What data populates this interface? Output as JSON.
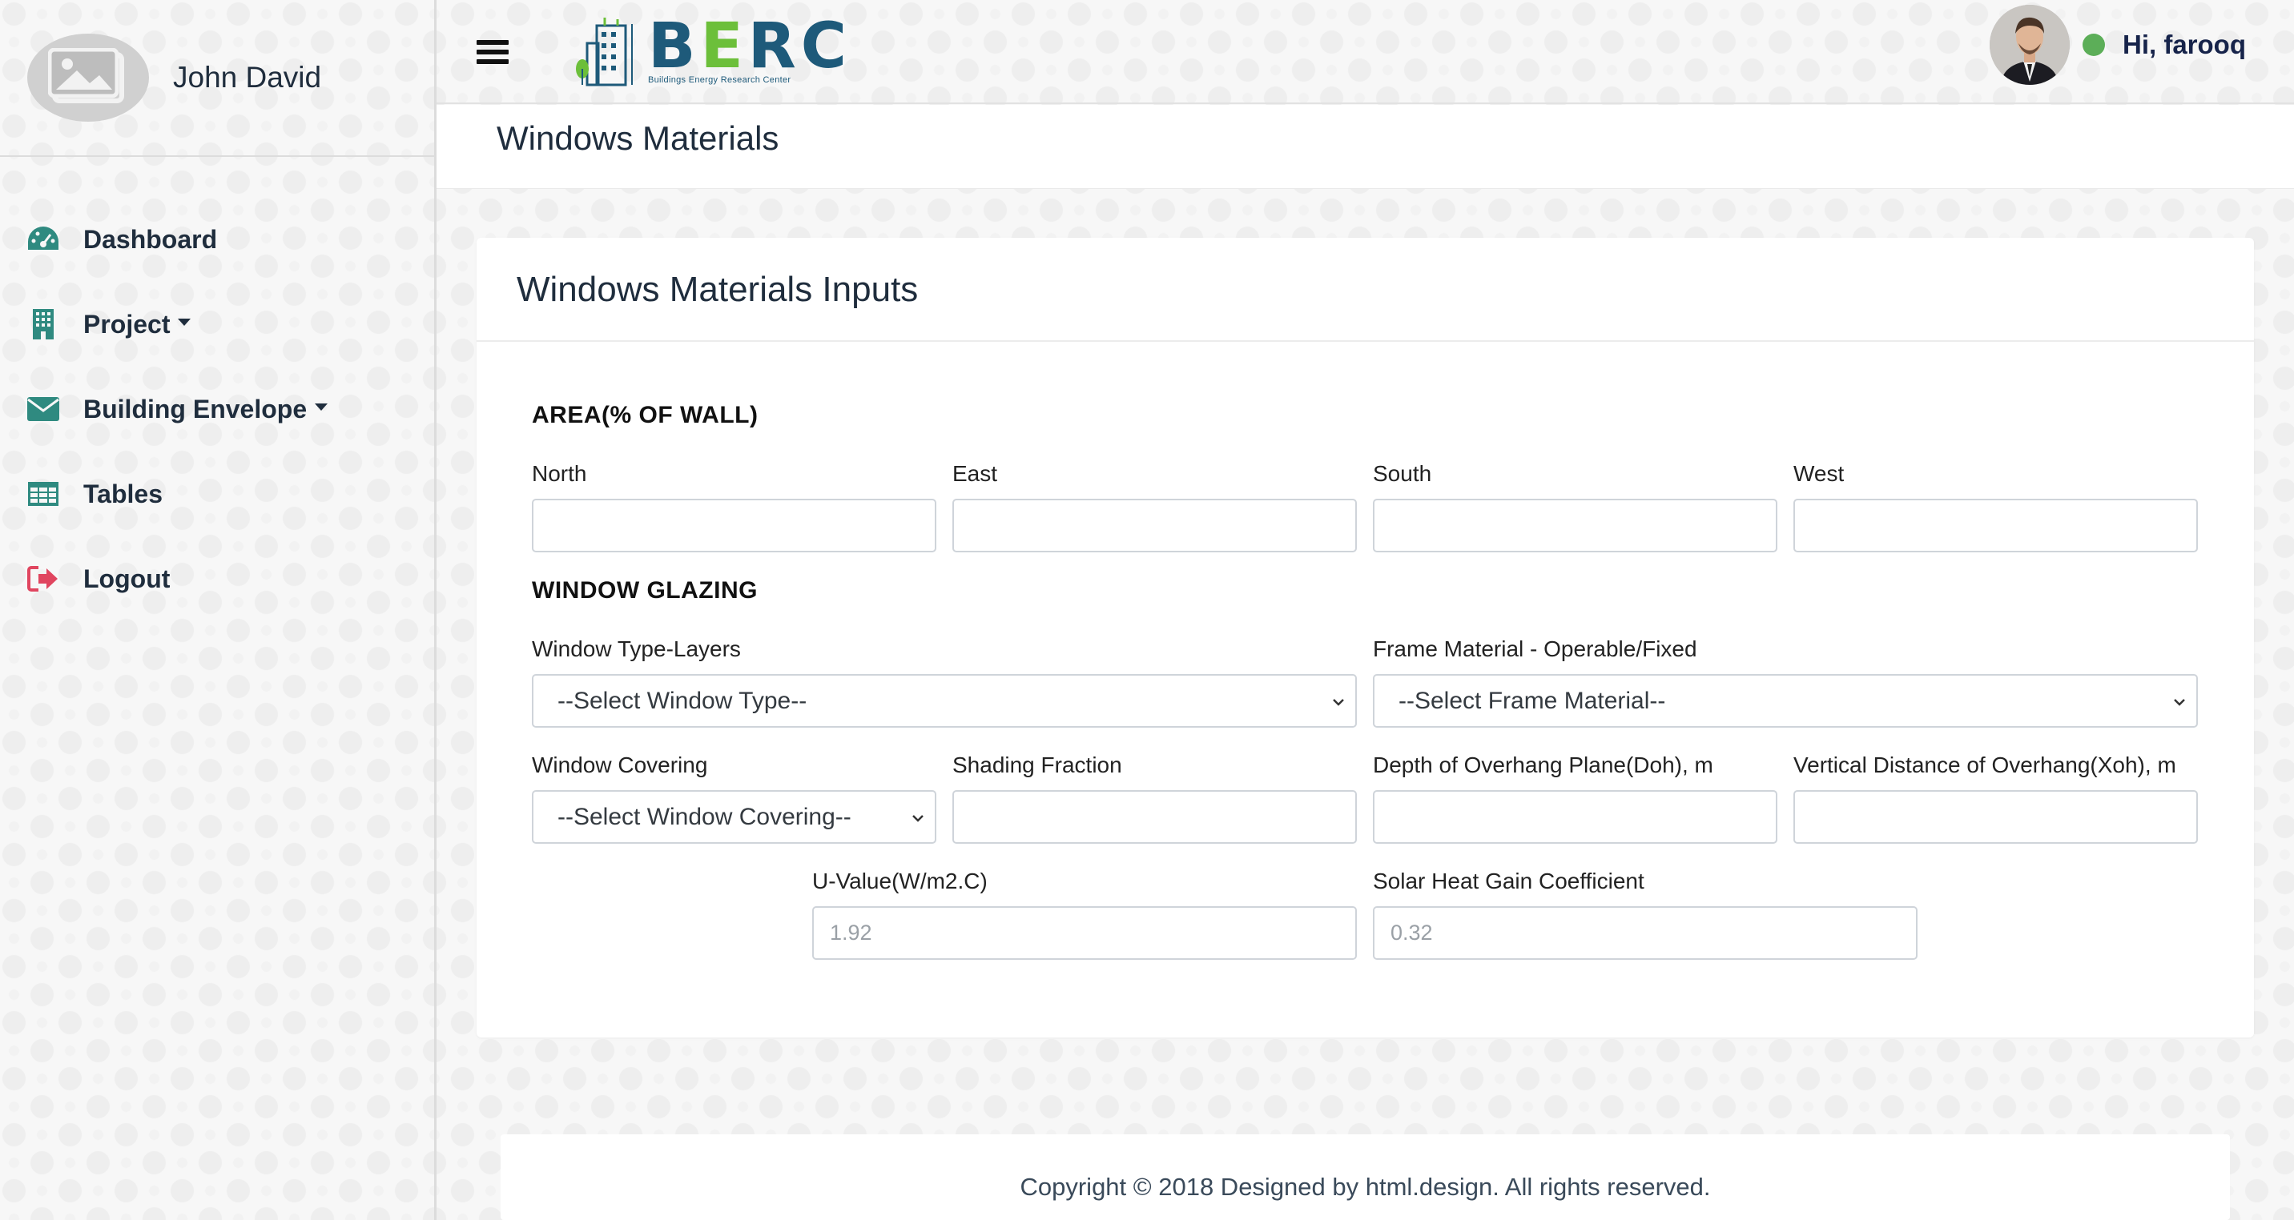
{
  "sidebar": {
    "user_name": "John David",
    "items": [
      {
        "label": "Dashboard",
        "icon": "dashboard-icon",
        "has_dropdown": false
      },
      {
        "label": "Project",
        "icon": "building-icon",
        "has_dropdown": true
      },
      {
        "label": "Building Envelope",
        "icon": "envelope-icon",
        "has_dropdown": true
      },
      {
        "label": "Tables",
        "icon": "table-icon",
        "has_dropdown": false
      },
      {
        "label": "Logout",
        "icon": "logout-icon",
        "has_dropdown": false
      }
    ]
  },
  "header": {
    "logo_text": "BERC",
    "logo_subtitle": "Buildings Energy Research Center",
    "greeting": "Hi, farooq",
    "status_color": "#5cae58"
  },
  "page": {
    "title": "Windows Materials"
  },
  "card": {
    "title": "Windows Materials Inputs",
    "area_section": {
      "title": "AREA(% OF WALL)",
      "fields": [
        {
          "label": "North",
          "value": "",
          "placeholder": ""
        },
        {
          "label": "East",
          "value": "",
          "placeholder": ""
        },
        {
          "label": "South",
          "value": "",
          "placeholder": ""
        },
        {
          "label": "West",
          "value": "",
          "placeholder": ""
        }
      ]
    },
    "glazing_section": {
      "title": "WINDOW GLAZING",
      "window_type": {
        "label": "Window Type-Layers",
        "selected": "--Select Window Type--"
      },
      "frame_material": {
        "label": "Frame Material - Operable/Fixed",
        "selected": "--Select Frame Material--"
      },
      "window_covering": {
        "label": "Window Covering",
        "selected": "--Select Window Covering--"
      },
      "shading_fraction": {
        "label": "Shading Fraction",
        "value": ""
      },
      "overhang_depth": {
        "label": "Depth of Overhang Plane(Doh), m",
        "value": ""
      },
      "overhang_distance": {
        "label": "Vertical Distance of Overhang(Xoh), m",
        "value": ""
      },
      "u_value": {
        "label": "U-Value(W/m2.C)",
        "placeholder": "1.92"
      },
      "shgc": {
        "label": "Solar Heat Gain Coefficient",
        "placeholder": "0.32"
      }
    }
  },
  "footer": {
    "copyright": "Copyright © 2018 Designed by html.design. All rights reserved."
  },
  "colors": {
    "icon_teal": "#2f8a80",
    "logout_red": "#e0455f",
    "brand_blue": "#1e5a7a",
    "brand_green": "#6cbf3a"
  }
}
